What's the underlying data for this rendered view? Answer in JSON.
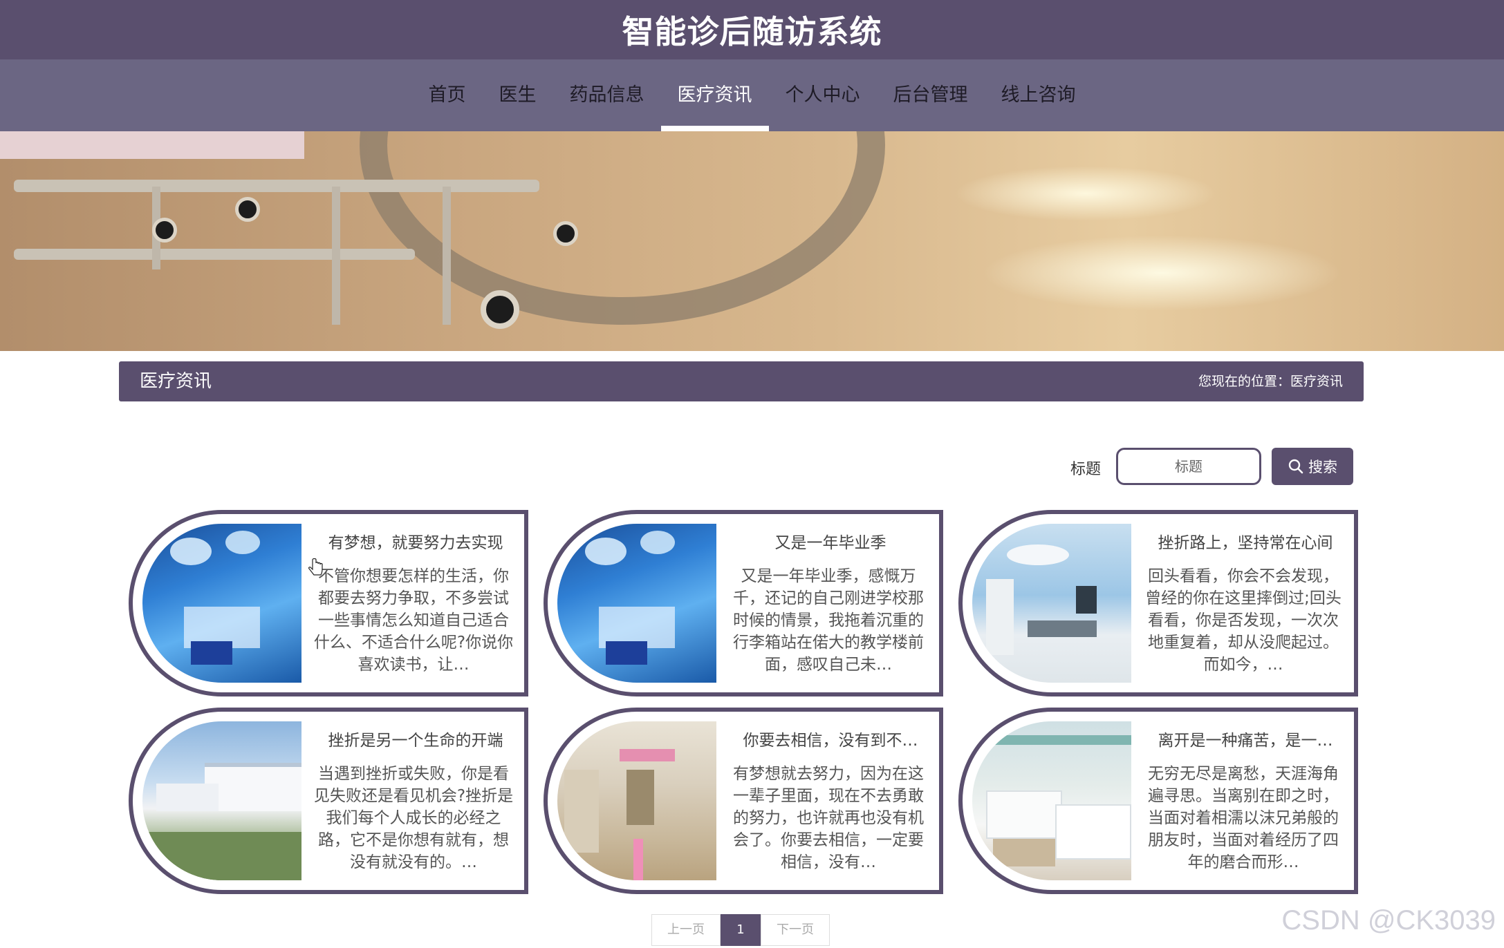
{
  "header": {
    "site_title": "智能诊后随访系统"
  },
  "nav": {
    "items": [
      {
        "label": "首页"
      },
      {
        "label": "医生"
      },
      {
        "label": "药品信息"
      },
      {
        "label": "医疗资讯"
      },
      {
        "label": "个人中心"
      },
      {
        "label": "后台管理"
      },
      {
        "label": "线上咨询"
      }
    ],
    "active_index": 3
  },
  "banner": {
    "slide_count": 3,
    "active_slide": 0
  },
  "section": {
    "title": "医疗资讯",
    "breadcrumb": "您现在的位置：医疗资讯"
  },
  "search": {
    "label": "标题",
    "placeholder": "标题",
    "value": "",
    "button_label": "搜索"
  },
  "articles": [
    {
      "title": "有梦想，就要努力去实现",
      "summary": "不管你想要怎样的生活，你都要去努力争取，不多尝试一些事情怎么知道自己适合什么、不适合什么呢?你说你喜欢读书，让…",
      "image": "operating-room"
    },
    {
      "title": "又是一年毕业季",
      "summary": "又是一年毕业季，感慨万千，还记的自己刚进学校那时候的情景，我拖着沉重的行李箱站在偌大的教学楼前面，感叹自己未…",
      "image": "operating-room"
    },
    {
      "title": "挫折路上，坚持常在心间",
      "summary": "回头看看，你会不会发现，曾经的你在这里摔倒过;回头看看，你是否发现，一次次地重复着，却从没爬起过。而如今，…",
      "image": "clinic-room"
    },
    {
      "title": "挫折是另一个生命的开端",
      "summary": "当遇到挫折或失败，你是看见失败还是看见机会?挫折是我们每个人成长的必经之路，它不是你想有就有，想没有就没有的。…",
      "image": "hospital-building"
    },
    {
      "title": "你要去相信，没有到不…",
      "summary": "有梦想就去努力，因为在这一辈子里面，现在不去勇敢的努力，也许就再也没有机会了。你要去相信，一定要相信，没有…",
      "image": "hospital-corridor"
    },
    {
      "title": "离开是一种痛苦，是一…",
      "summary": "无穷无尽是离愁，天涯海角遍寻思。当离别在即之时，当面对着相濡以沫兄弟般的朋友时，当面对着经历了四年的磨合而形…",
      "image": "ward-room"
    }
  ],
  "pagination": {
    "prev_label": "上一页",
    "current": "1",
    "next_label": "下一页"
  },
  "watermark": "CSDN @CK3039",
  "colors": {
    "primary": "#5a4f6e",
    "nav_bg": "#6b6683"
  }
}
